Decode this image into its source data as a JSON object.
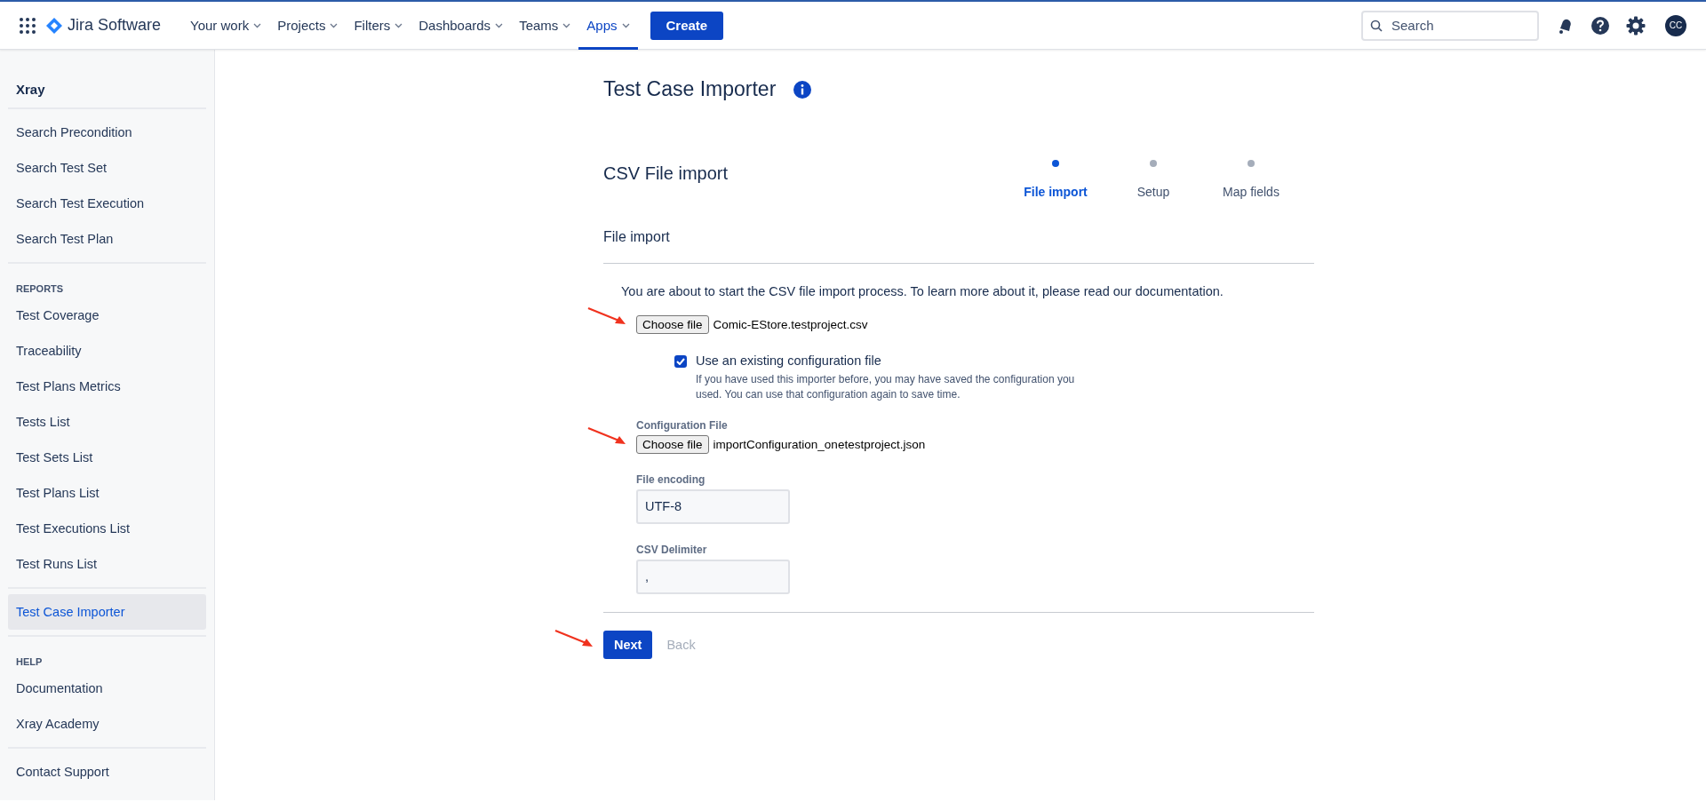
{
  "nav": {
    "product": "Jira Software",
    "items": [
      {
        "label": "Your work",
        "selected": false
      },
      {
        "label": "Projects",
        "selected": false
      },
      {
        "label": "Filters",
        "selected": false
      },
      {
        "label": "Dashboards",
        "selected": false
      },
      {
        "label": "Teams",
        "selected": false
      },
      {
        "label": "Apps",
        "selected": true
      }
    ],
    "create": "Create",
    "search": {
      "placeholder": "Search"
    },
    "avatar": "CC"
  },
  "sidebar": {
    "title": "Xray",
    "sections": [
      {
        "items": [
          {
            "label": "Search Precondition",
            "selected": false
          },
          {
            "label": "Search Test Set",
            "selected": false
          },
          {
            "label": "Search Test Execution",
            "selected": false
          },
          {
            "label": "Search Test Plan",
            "selected": false
          }
        ]
      },
      {
        "heading": "REPORTS",
        "items": [
          {
            "label": "Test Coverage",
            "selected": false
          },
          {
            "label": "Traceability",
            "selected": false
          },
          {
            "label": "Test Plans Metrics",
            "selected": false
          },
          {
            "label": "Tests List",
            "selected": false
          },
          {
            "label": "Test Sets List",
            "selected": false
          },
          {
            "label": "Test Plans List",
            "selected": false
          },
          {
            "label": "Test Executions List",
            "selected": false
          },
          {
            "label": "Test Runs List",
            "selected": false
          }
        ]
      },
      {
        "items": [
          {
            "label": "Test Case Importer",
            "selected": true
          }
        ]
      },
      {
        "heading": "HELP",
        "items": [
          {
            "label": "Documentation",
            "selected": false
          },
          {
            "label": "Xray Academy",
            "selected": false
          }
        ]
      },
      {
        "items": [
          {
            "label": "Contact Support",
            "selected": false
          }
        ]
      }
    ]
  },
  "page": {
    "title": "Test Case Importer",
    "section_title": "CSV File import",
    "steps": [
      {
        "label": "File import",
        "selected": true
      },
      {
        "label": "Setup",
        "selected": false
      },
      {
        "label": "Map fields",
        "selected": false
      }
    ],
    "subheading": "File import",
    "intro": "You are about to start the CSV file import process. To learn more about it, please read our documentation.",
    "file_input": {
      "button": "Choose file",
      "filename": "Comic-EStore.testproject.csv"
    },
    "checkbox": {
      "label": "Use an existing configuration file",
      "checked": true,
      "help": "If you have used this importer before, you may have saved the configuration you used. You can use that configuration again to save time."
    },
    "config_file": {
      "label": "Configuration File",
      "button": "Choose file",
      "filename": "importConfiguration_onetestproject.json"
    },
    "fields": [
      {
        "label": "File encoding",
        "value": "UTF-8"
      },
      {
        "label": "CSV Delimiter",
        "value": ","
      }
    ],
    "buttons": [
      {
        "label": "Next",
        "kind": "primary",
        "disabled": false
      },
      {
        "label": "Back",
        "kind": "subtle",
        "disabled": true
      }
    ]
  }
}
